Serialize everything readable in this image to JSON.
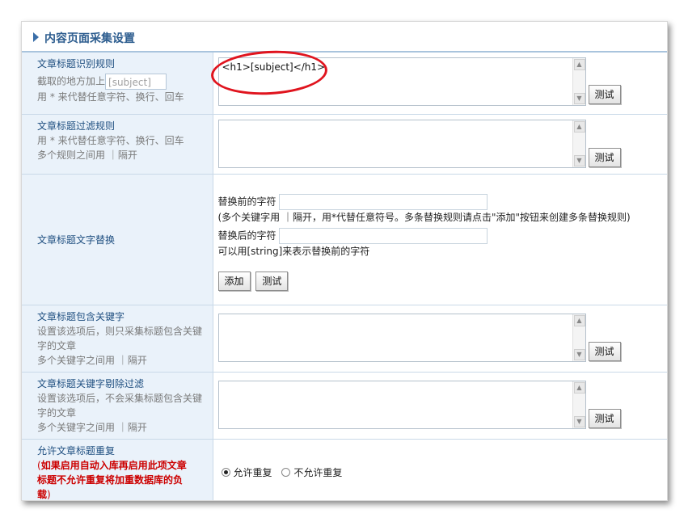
{
  "panel": {
    "title": "内容页面采集设置"
  },
  "rows": {
    "title_rule": {
      "label": "文章标题识别规则",
      "desc_prefix": "截取的地方加上",
      "inline_placeholder": "[subject]",
      "desc2": "用 * 来代替任意字符、换行、回车",
      "value": "<h1>[subject]</h1>",
      "test_label": "测试"
    },
    "title_filter": {
      "label": "文章标题过滤规则",
      "desc1": "用 * 来代替任意字符、换行、回车",
      "desc2": "多个规则之间用 ｜隔开",
      "value": "",
      "test_label": "测试"
    },
    "title_replace": {
      "label": "文章标题文字替换",
      "before_label": "替换前的字符",
      "before_note": "(多个关键字用 ｜隔开，用*代替任意符号。多条替换规则请点击\"添加\"按钮来创建多条替换规则)",
      "after_label": "替换后的字符",
      "after_note": "可以用[string]来表示替换前的字符",
      "add_label": "添加",
      "test_label": "测试"
    },
    "title_include": {
      "label": "文章标题包含关键字",
      "desc1": "设置该选项后，则只采集标题包含关键",
      "desc2": "字的文章",
      "desc3": "多个关键字之间用 ｜隔开",
      "value": "",
      "test_label": "测试"
    },
    "title_exclude": {
      "label": "文章标题关键字剔除过滤",
      "desc1": "设置该选项后，不会采集标题包含关键",
      "desc2": "字的文章",
      "desc3": "多个关键字之间用 ｜隔开",
      "value": "",
      "test_label": "测试"
    },
    "title_dup": {
      "label": "允许文章标题重复",
      "warn_open": "(",
      "warn1": "如果启用自动入库再启用此项文章",
      "warn2": "标题不允许重复将加重数据库的负",
      "warn3": "载",
      "warn_close": ")",
      "opt_allow": "允许重复",
      "opt_deny": "不允许重复",
      "selected": "允许重复"
    }
  },
  "colors": {
    "accent": "#2d5d8f",
    "label_bg": "#eaf2fa",
    "warning": "#cc0000",
    "highlight": "#e0141e"
  },
  "icons": [
    "triangle-right-icon",
    "scroll-up-icon",
    "scroll-down-icon",
    "radio-icon"
  ]
}
